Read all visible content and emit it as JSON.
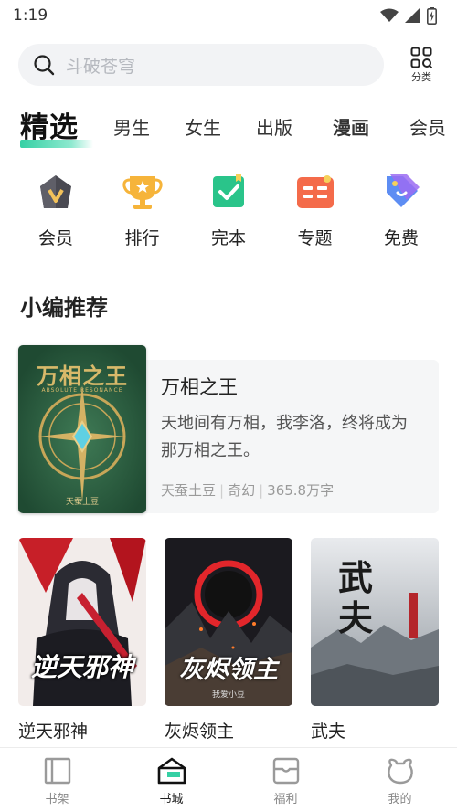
{
  "status": {
    "time": "1:19"
  },
  "search": {
    "placeholder": "斗破苍穹"
  },
  "category": {
    "label": "分类"
  },
  "tabs": [
    {
      "label": "精选",
      "active": true
    },
    {
      "label": "男生"
    },
    {
      "label": "女生"
    },
    {
      "label": "出版"
    },
    {
      "label": "漫画"
    },
    {
      "label": "会员"
    }
  ],
  "quick": [
    {
      "label": "会员",
      "icon": "vip-crown-icon"
    },
    {
      "label": "排行",
      "icon": "trophy-icon"
    },
    {
      "label": "完本",
      "icon": "finished-check-icon"
    },
    {
      "label": "专题",
      "icon": "topic-icon"
    },
    {
      "label": "免费",
      "icon": "free-tag-icon"
    }
  ],
  "recommend": {
    "title": "小编推荐",
    "featured": {
      "title": "万相之王",
      "desc": "天地间有万相，我李洛，终将成为那万相之王。",
      "author": "天蚕土豆",
      "genre": "奇幻",
      "words": "365.8万字",
      "cover_title": "万相之王",
      "cover_subtitle": "ABSOLUTE RESONANCE",
      "cover_author": "天蚕土豆"
    },
    "books": [
      {
        "title": "逆天邪神",
        "cover_text": "逆天邪神"
      },
      {
        "title": "灰烬领主",
        "cover_text": "灰烬领主",
        "cover_author": "我爱小豆"
      },
      {
        "title": "武夫",
        "cover_text": "武夫"
      }
    ]
  },
  "nav": [
    {
      "label": "书架",
      "icon": "bookshelf-icon"
    },
    {
      "label": "书城",
      "icon": "bookstore-icon",
      "active": true
    },
    {
      "label": "福利",
      "icon": "welfare-icon"
    },
    {
      "label": "我的",
      "icon": "profile-bear-icon"
    }
  ],
  "colors": {
    "accent": "#35d0a4",
    "text": "#222222",
    "muted": "#9a9a9a"
  }
}
